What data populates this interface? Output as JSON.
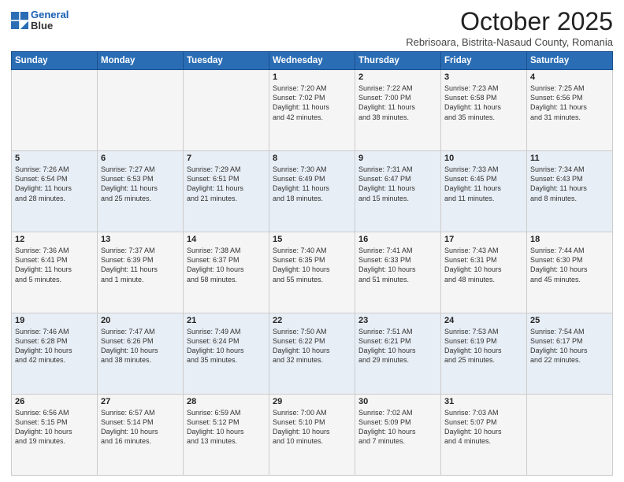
{
  "header": {
    "logo_line1": "General",
    "logo_line2": "Blue",
    "month": "October 2025",
    "location": "Rebrisoara, Bistrita-Nasaud County, Romania"
  },
  "weekdays": [
    "Sunday",
    "Monday",
    "Tuesday",
    "Wednesday",
    "Thursday",
    "Friday",
    "Saturday"
  ],
  "weeks": [
    [
      {
        "day": "",
        "info": ""
      },
      {
        "day": "",
        "info": ""
      },
      {
        "day": "",
        "info": ""
      },
      {
        "day": "1",
        "info": "Sunrise: 7:20 AM\nSunset: 7:02 PM\nDaylight: 11 hours\nand 42 minutes."
      },
      {
        "day": "2",
        "info": "Sunrise: 7:22 AM\nSunset: 7:00 PM\nDaylight: 11 hours\nand 38 minutes."
      },
      {
        "day": "3",
        "info": "Sunrise: 7:23 AM\nSunset: 6:58 PM\nDaylight: 11 hours\nand 35 minutes."
      },
      {
        "day": "4",
        "info": "Sunrise: 7:25 AM\nSunset: 6:56 PM\nDaylight: 11 hours\nand 31 minutes."
      }
    ],
    [
      {
        "day": "5",
        "info": "Sunrise: 7:26 AM\nSunset: 6:54 PM\nDaylight: 11 hours\nand 28 minutes."
      },
      {
        "day": "6",
        "info": "Sunrise: 7:27 AM\nSunset: 6:53 PM\nDaylight: 11 hours\nand 25 minutes."
      },
      {
        "day": "7",
        "info": "Sunrise: 7:29 AM\nSunset: 6:51 PM\nDaylight: 11 hours\nand 21 minutes."
      },
      {
        "day": "8",
        "info": "Sunrise: 7:30 AM\nSunset: 6:49 PM\nDaylight: 11 hours\nand 18 minutes."
      },
      {
        "day": "9",
        "info": "Sunrise: 7:31 AM\nSunset: 6:47 PM\nDaylight: 11 hours\nand 15 minutes."
      },
      {
        "day": "10",
        "info": "Sunrise: 7:33 AM\nSunset: 6:45 PM\nDaylight: 11 hours\nand 11 minutes."
      },
      {
        "day": "11",
        "info": "Sunrise: 7:34 AM\nSunset: 6:43 PM\nDaylight: 11 hours\nand 8 minutes."
      }
    ],
    [
      {
        "day": "12",
        "info": "Sunrise: 7:36 AM\nSunset: 6:41 PM\nDaylight: 11 hours\nand 5 minutes."
      },
      {
        "day": "13",
        "info": "Sunrise: 7:37 AM\nSunset: 6:39 PM\nDaylight: 11 hours\nand 1 minute."
      },
      {
        "day": "14",
        "info": "Sunrise: 7:38 AM\nSunset: 6:37 PM\nDaylight: 10 hours\nand 58 minutes."
      },
      {
        "day": "15",
        "info": "Sunrise: 7:40 AM\nSunset: 6:35 PM\nDaylight: 10 hours\nand 55 minutes."
      },
      {
        "day": "16",
        "info": "Sunrise: 7:41 AM\nSunset: 6:33 PM\nDaylight: 10 hours\nand 51 minutes."
      },
      {
        "day": "17",
        "info": "Sunrise: 7:43 AM\nSunset: 6:31 PM\nDaylight: 10 hours\nand 48 minutes."
      },
      {
        "day": "18",
        "info": "Sunrise: 7:44 AM\nSunset: 6:30 PM\nDaylight: 10 hours\nand 45 minutes."
      }
    ],
    [
      {
        "day": "19",
        "info": "Sunrise: 7:46 AM\nSunset: 6:28 PM\nDaylight: 10 hours\nand 42 minutes."
      },
      {
        "day": "20",
        "info": "Sunrise: 7:47 AM\nSunset: 6:26 PM\nDaylight: 10 hours\nand 38 minutes."
      },
      {
        "day": "21",
        "info": "Sunrise: 7:49 AM\nSunset: 6:24 PM\nDaylight: 10 hours\nand 35 minutes."
      },
      {
        "day": "22",
        "info": "Sunrise: 7:50 AM\nSunset: 6:22 PM\nDaylight: 10 hours\nand 32 minutes."
      },
      {
        "day": "23",
        "info": "Sunrise: 7:51 AM\nSunset: 6:21 PM\nDaylight: 10 hours\nand 29 minutes."
      },
      {
        "day": "24",
        "info": "Sunrise: 7:53 AM\nSunset: 6:19 PM\nDaylight: 10 hours\nand 25 minutes."
      },
      {
        "day": "25",
        "info": "Sunrise: 7:54 AM\nSunset: 6:17 PM\nDaylight: 10 hours\nand 22 minutes."
      }
    ],
    [
      {
        "day": "26",
        "info": "Sunrise: 6:56 AM\nSunset: 5:15 PM\nDaylight: 10 hours\nand 19 minutes."
      },
      {
        "day": "27",
        "info": "Sunrise: 6:57 AM\nSunset: 5:14 PM\nDaylight: 10 hours\nand 16 minutes."
      },
      {
        "day": "28",
        "info": "Sunrise: 6:59 AM\nSunset: 5:12 PM\nDaylight: 10 hours\nand 13 minutes."
      },
      {
        "day": "29",
        "info": "Sunrise: 7:00 AM\nSunset: 5:10 PM\nDaylight: 10 hours\nand 10 minutes."
      },
      {
        "day": "30",
        "info": "Sunrise: 7:02 AM\nSunset: 5:09 PM\nDaylight: 10 hours\nand 7 minutes."
      },
      {
        "day": "31",
        "info": "Sunrise: 7:03 AM\nSunset: 5:07 PM\nDaylight: 10 hours\nand 4 minutes."
      },
      {
        "day": "",
        "info": ""
      }
    ]
  ]
}
